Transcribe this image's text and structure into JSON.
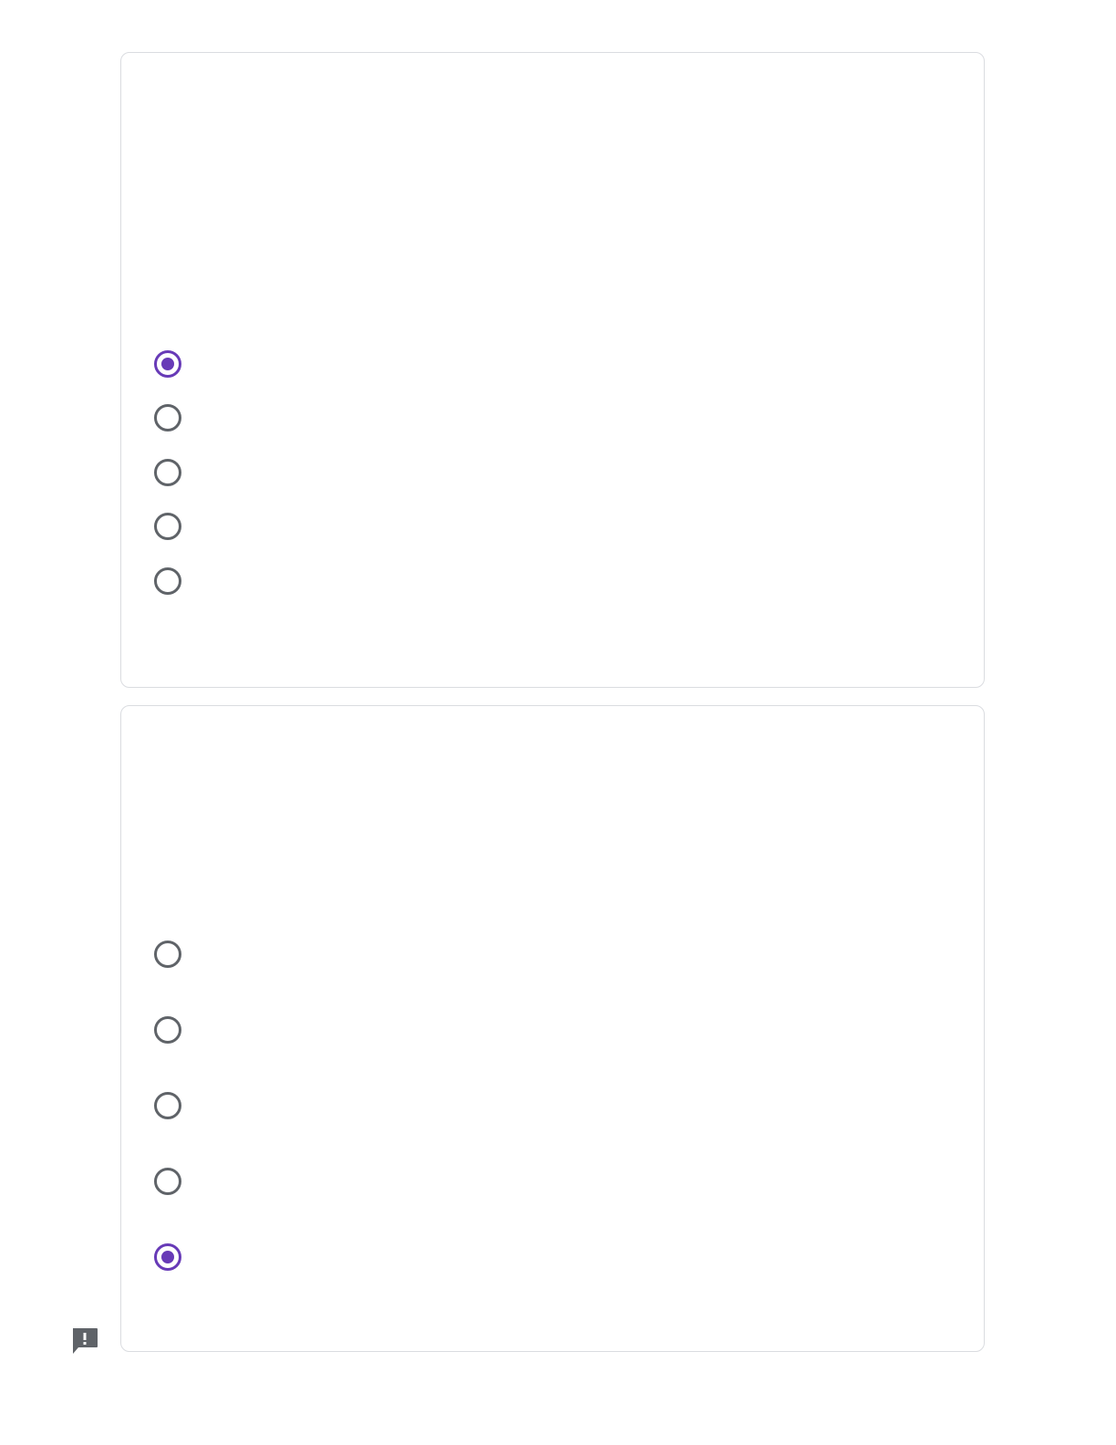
{
  "theme": {
    "accent": "#673ab7",
    "radio_border": "#5f6368",
    "card_border": "#dadce0"
  },
  "questions": [
    {
      "title": "",
      "options": [
        {
          "label": "",
          "checked": true
        },
        {
          "label": "",
          "checked": false
        },
        {
          "label": "",
          "checked": false
        },
        {
          "label": "",
          "checked": false
        },
        {
          "label": "",
          "checked": false
        }
      ]
    },
    {
      "title": "",
      "options": [
        {
          "label": "",
          "checked": false
        },
        {
          "label": "",
          "checked": false
        },
        {
          "label": "",
          "checked": false
        },
        {
          "label": "",
          "checked": false
        },
        {
          "label": "",
          "checked": true
        }
      ]
    }
  ],
  "feedback": {
    "icon": "report-feedback-icon"
  }
}
